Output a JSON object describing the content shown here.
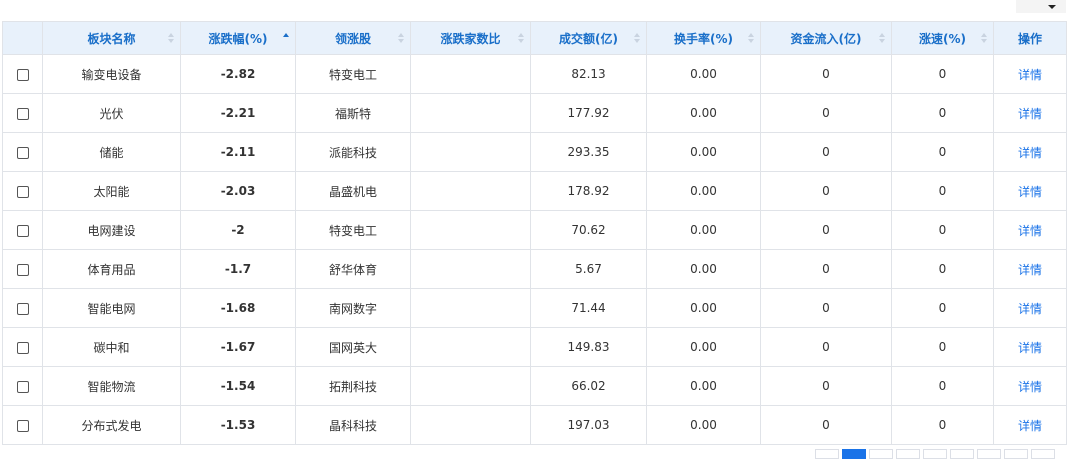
{
  "columns": [
    {
      "key": "name",
      "label": "板块名称"
    },
    {
      "key": "change",
      "label": "涨跌幅(%)"
    },
    {
      "key": "leader",
      "label": "领涨股"
    },
    {
      "key": "updown",
      "label": "涨跌家数比"
    },
    {
      "key": "turnover",
      "label": "成交额(亿)"
    },
    {
      "key": "rate",
      "label": "换手率(%)"
    },
    {
      "key": "inflow",
      "label": "资金流入(亿)"
    },
    {
      "key": "speed",
      "label": "涨速(%)"
    },
    {
      "key": "action",
      "label": "操作"
    }
  ],
  "rows": [
    {
      "name": "输变电设备",
      "change": "-2.82",
      "leader": "特变电工",
      "updown": "",
      "turnover": "82.13",
      "rate": "0.00",
      "inflow": "0",
      "speed": "0",
      "action": "详情"
    },
    {
      "name": "光伏",
      "change": "-2.21",
      "leader": "福斯特",
      "updown": "",
      "turnover": "177.92",
      "rate": "0.00",
      "inflow": "0",
      "speed": "0",
      "action": "详情"
    },
    {
      "name": "储能",
      "change": "-2.11",
      "leader": "派能科技",
      "updown": "",
      "turnover": "293.35",
      "rate": "0.00",
      "inflow": "0",
      "speed": "0",
      "action": "详情"
    },
    {
      "name": "太阳能",
      "change": "-2.03",
      "leader": "晶盛机电",
      "updown": "",
      "turnover": "178.92",
      "rate": "0.00",
      "inflow": "0",
      "speed": "0",
      "action": "详情"
    },
    {
      "name": "电网建设",
      "change": "-2",
      "leader": "特变电工",
      "updown": "",
      "turnover": "70.62",
      "rate": "0.00",
      "inflow": "0",
      "speed": "0",
      "action": "详情"
    },
    {
      "name": "体育用品",
      "change": "-1.7",
      "leader": "舒华体育",
      "updown": "",
      "turnover": "5.67",
      "rate": "0.00",
      "inflow": "0",
      "speed": "0",
      "action": "详情"
    },
    {
      "name": "智能电网",
      "change": "-1.68",
      "leader": "南网数字",
      "updown": "",
      "turnover": "71.44",
      "rate": "0.00",
      "inflow": "0",
      "speed": "0",
      "action": "详情"
    },
    {
      "name": "碳中和",
      "change": "-1.67",
      "leader": "国网英大",
      "updown": "",
      "turnover": "149.83",
      "rate": "0.00",
      "inflow": "0",
      "speed": "0",
      "action": "详情"
    },
    {
      "name": "智能物流",
      "change": "-1.54",
      "leader": "拓荆科技",
      "updown": "",
      "turnover": "66.02",
      "rate": "0.00",
      "inflow": "0",
      "speed": "0",
      "action": "详情"
    },
    {
      "name": "分布式发电",
      "change": "-1.53",
      "leader": "晶科科技",
      "updown": "",
      "turnover": "197.03",
      "rate": "0.00",
      "inflow": "0",
      "speed": "0",
      "action": "详情"
    }
  ],
  "sort": {
    "column": "change",
    "direction": "asc"
  },
  "colors": {
    "header_bg": "#e8f1fb",
    "header_text": "#1a6fc9",
    "negative": "#17a34a",
    "link": "#1a73e8",
    "border": "#e0e3e8"
  }
}
